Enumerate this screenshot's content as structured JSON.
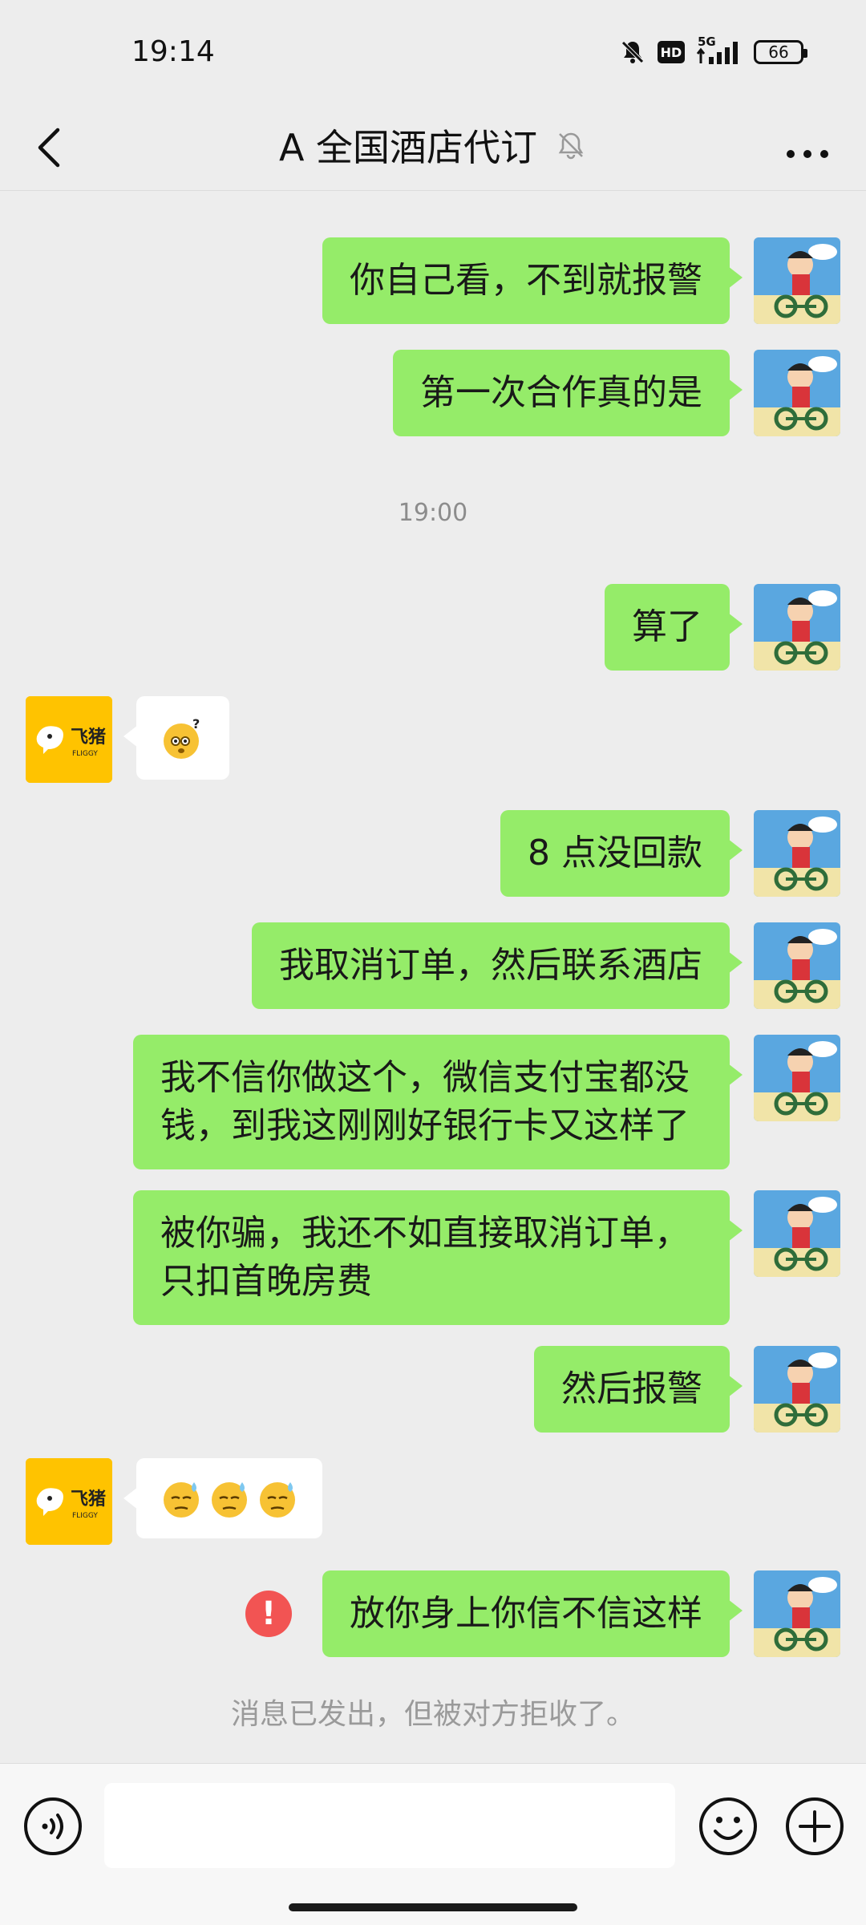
{
  "status_bar": {
    "time": "19:14",
    "network": "5G",
    "hd": "HD",
    "battery": "66"
  },
  "nav": {
    "title": "A 全国酒店代订",
    "back_icon": "chevron-left-icon",
    "mute_icon": "bell-off-icon",
    "more_icon": "more-dots-icon"
  },
  "messages": [
    {
      "side": "right",
      "text": "你自己看，不到就报警"
    },
    {
      "side": "right",
      "text": "第一次合作真的是"
    },
    {
      "type": "time",
      "text": "19:00"
    },
    {
      "side": "right",
      "text": "算了"
    },
    {
      "side": "left",
      "emoji": [
        "thinking-question-emoji"
      ]
    },
    {
      "side": "right",
      "text": "8 点没回款"
    },
    {
      "side": "right",
      "text": "我取消订单，然后联系酒店"
    },
    {
      "side": "right",
      "text_lines": [
        "我不信你做这个，微信支付宝都没",
        "钱，到我这刚刚好银行卡又这样了"
      ]
    },
    {
      "side": "right",
      "text_lines": [
        "被你骗，我还不如直接取消订单，",
        "只扣首晚房费"
      ]
    },
    {
      "side": "right",
      "text": "然后报警"
    },
    {
      "side": "left",
      "emoji": [
        "sweat-emoji",
        "sweat-emoji",
        "sweat-emoji"
      ]
    },
    {
      "side": "right",
      "text": "放你身上你信不信这样",
      "failed": true
    },
    {
      "type": "system",
      "text": "消息已发出，但被对方拒收了。"
    }
  ],
  "left_avatar": {
    "label": "飞猪",
    "sub": "FLIGGY",
    "color": "#ffc300"
  },
  "colors": {
    "bubble_self": "#95ec69",
    "bubble_other": "#ffffff",
    "background": "#ededed",
    "error": "#f25453"
  },
  "input": {
    "placeholder": "",
    "voice_icon": "voice-icon",
    "emoji_icon": "emoji-icon",
    "plus_icon": "plus-icon"
  }
}
